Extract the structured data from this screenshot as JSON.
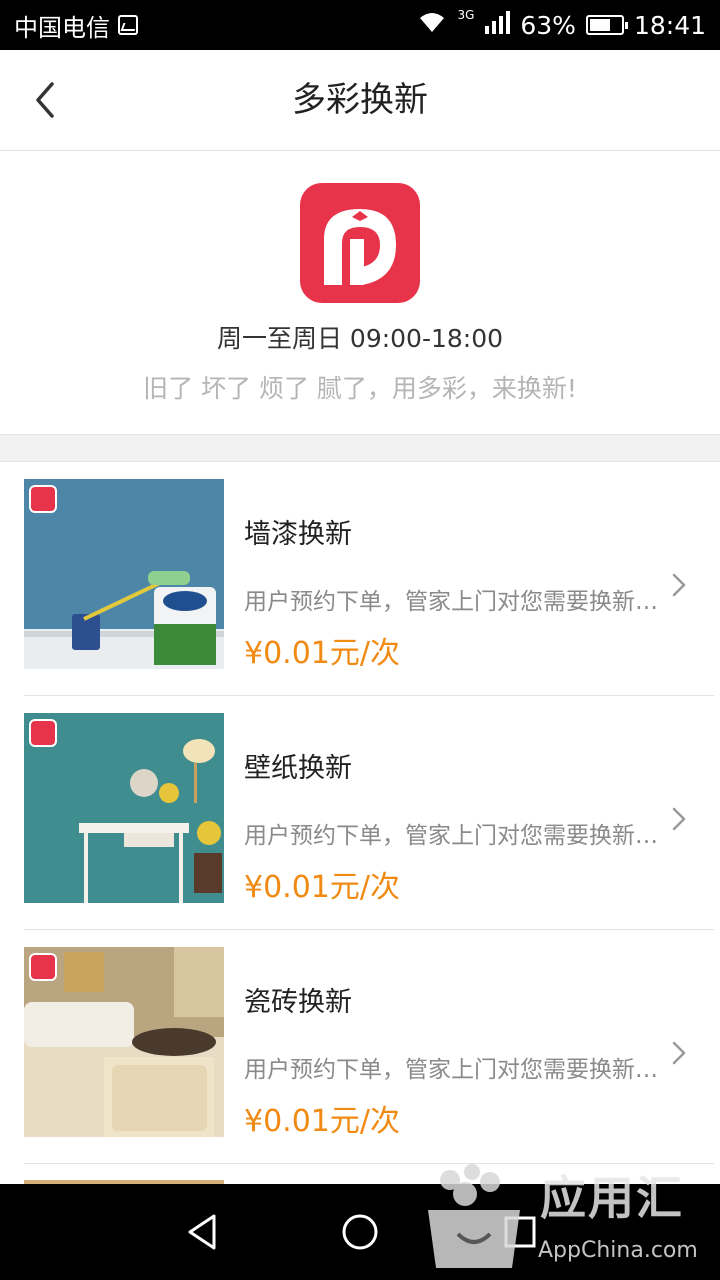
{
  "status_bar": {
    "carrier": "中国电信",
    "network": "3G",
    "battery": "63%",
    "time": "18:41",
    "icons": [
      "image-icon",
      "wifi-icon",
      "signal-icon",
      "battery-icon"
    ]
  },
  "nav": {
    "title": "多彩换新",
    "back_icon": "chevron-left-icon"
  },
  "info": {
    "logo_icon": "app-logo",
    "hours": "周一至周日 09:00-18:00",
    "slogan": "旧了 坏了 烦了 腻了，用多彩，来换新!"
  },
  "services": [
    {
      "title": "墙漆换新",
      "desc": "用户预约下单，管家上门对您需要换新的墙面进行查看",
      "price": "¥0.01元/次",
      "image": "wall-paint-image"
    },
    {
      "title": "壁纸换新",
      "desc": "用户预约下单，管家上门对您需要换新的墙面进行查看",
      "price": "¥0.01元/次",
      "image": "wallpaper-image"
    },
    {
      "title": "瓷砖换新",
      "desc": "用户预约下单，管家上门对您需要换新的地面进行查看",
      "price": "¥0.01元/次",
      "image": "tile-image"
    }
  ],
  "colors": {
    "brand": "#e8344a",
    "price": "#f08a12",
    "muted": "#b5b5b5"
  },
  "watermark": {
    "text": "应用汇",
    "sub": "AppChina.com"
  }
}
